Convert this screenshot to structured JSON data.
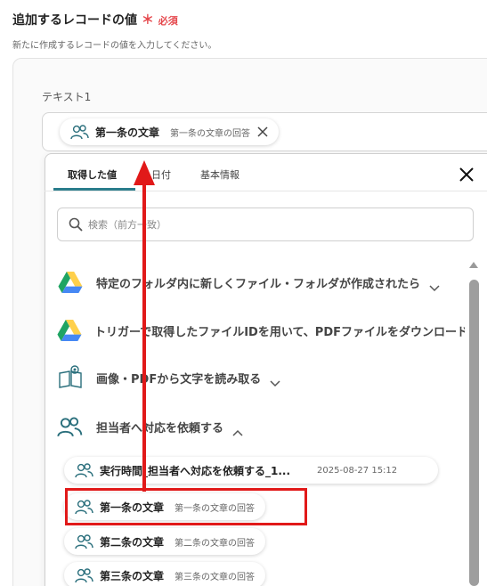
{
  "section": {
    "title": "追加するレコードの値",
    "required_star": "＊",
    "required_text": "必須",
    "description": "新たに作成するレコードの値を入力してください。"
  },
  "field": {
    "label": "テキスト1",
    "selected_chip": {
      "name": "第一条の文章",
      "source": "第一条の文章の回答"
    }
  },
  "dropdown": {
    "tabs": [
      {
        "label": "取得した値",
        "active": true
      },
      {
        "label": "日付",
        "active": false
      },
      {
        "label": "基本情報",
        "active": false
      }
    ],
    "search_placeholder": "検索（前方一致）",
    "groups": [
      {
        "label": "特定のフォルダ内に新しくファイル・フォルダが作成されたら",
        "icon": "google-drive-icon"
      },
      {
        "label": "トリガーで取得したファイルIDを用いて、PDFファイルをダウンロード",
        "icon": "google-drive-icon"
      },
      {
        "label": "画像・PDFから文字を読み取る",
        "icon": "ocr-book-icon"
      },
      {
        "label": "担当者へ対応を依頼する",
        "icon": "users-icon",
        "expanded": true
      }
    ],
    "items": [
      {
        "name": "実行時間_担当者へ対応を依頼する_1...",
        "value": "2025-08-27 15:12"
      },
      {
        "name": "第一条の文章",
        "value": "第一条の文章の回答",
        "highlighted": true
      },
      {
        "name": "第二条の文章",
        "value": "第二条の文章の回答"
      },
      {
        "name": "第三条の文章",
        "value": "第三条の文章の回答"
      }
    ]
  },
  "colors": {
    "accent": "#2a7d8c",
    "required": "#e5484d",
    "annotation": "#e11919",
    "drive_green": "#1fa463",
    "drive_yellow": "#ffd04b",
    "drive_blue": "#4688f4"
  }
}
